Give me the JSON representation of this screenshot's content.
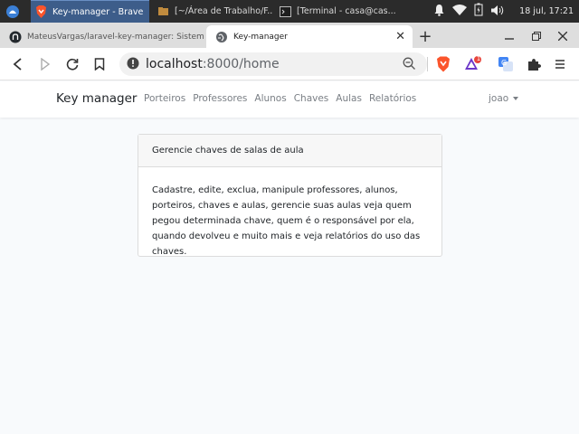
{
  "taskbar": {
    "tasks": [
      {
        "label": "Key-manager - Brave",
        "active": true
      },
      {
        "label": "[~/Área de Trabalho/F...",
        "active": false
      },
      {
        "label": "[Terminal - casa@cas...",
        "active": false
      }
    ],
    "clock": "18 jul, 17:21"
  },
  "browser": {
    "tabs": [
      {
        "label": "MateusVargas/laravel-key-manager: Sistem"
      },
      {
        "label": "Key-manager"
      }
    ],
    "url_host": "localhost",
    "url_path": ":8000/home",
    "extension_badge": "1"
  },
  "navbar": {
    "brand": "Key manager",
    "links": [
      "Porteiros",
      "Professores",
      "Alunos",
      "Chaves",
      "Aulas",
      "Relatórios"
    ],
    "user": "joao"
  },
  "card": {
    "header": "Gerencie chaves de salas de aula",
    "body": "Cadastre, edite, exclua, manipule professores, alunos, porteiros, chaves e aulas, gerencie suas aulas veja quem pegou determinada chave, quem é o responsável por ela, quando devolveu e muito mais e veja relatórios do uso das chaves."
  },
  "colors": {
    "taskbar_bg": "#2b2b2b",
    "active_task_bg": "#3d5d8a",
    "page_bg": "#f8fafc",
    "brave_orange": "#fb542b"
  }
}
